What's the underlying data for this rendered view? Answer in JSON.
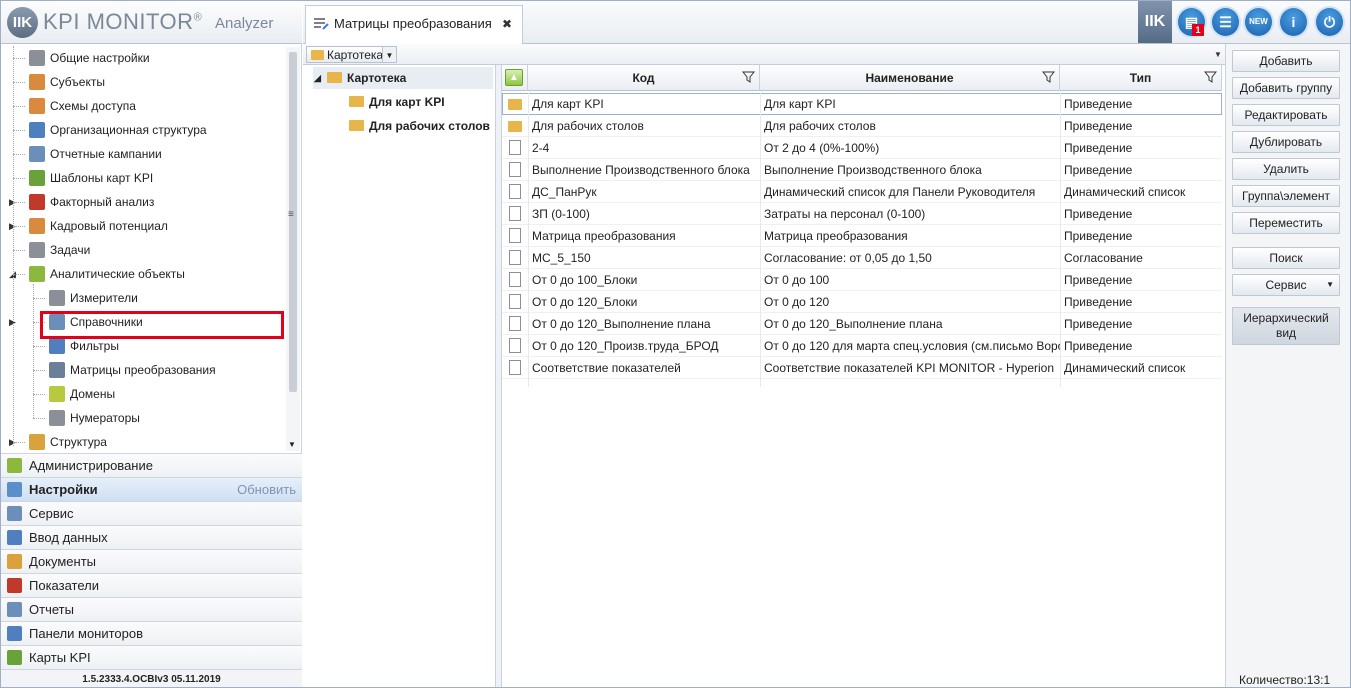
{
  "app": {
    "logo_mark": "IIK",
    "title": "KPI MONITOR",
    "reg": "®",
    "subtitle": "Analyzer",
    "version": "1.5.2333.4.OCBIv3  05.11.2019"
  },
  "tree": {
    "items": [
      {
        "label": "Общие настройки",
        "icon": "gear-icon",
        "color": "#8b8f97"
      },
      {
        "label": "Субъекты",
        "icon": "users-icon",
        "color": "#d98a3c"
      },
      {
        "label": "Схемы доступа",
        "icon": "access-icon",
        "color": "#d98a3c"
      },
      {
        "label": "Организационная структура",
        "icon": "org-icon",
        "color": "#4f7fbf"
      },
      {
        "label": "Отчетные кампании",
        "icon": "calendar-icon",
        "color": "#6b8fb8"
      },
      {
        "label": "Шаблоны карт KPI",
        "icon": "template-icon",
        "color": "#6aa23a"
      },
      {
        "label": "Факторный анализ",
        "icon": "beta-icon",
        "color": "#c0392b"
      },
      {
        "label": "Кадровый потенциал",
        "icon": "people-icon",
        "color": "#d98a3c"
      },
      {
        "label": "Задачи",
        "icon": "tasks-icon",
        "color": "#8b8f97"
      },
      {
        "label": "Аналитические объекты",
        "icon": "cubes-icon",
        "color": "#8cb83f"
      },
      {
        "label": "Измерители",
        "icon": "meter-icon",
        "color": "#8b8f97"
      },
      {
        "label": "Справочники",
        "icon": "book-icon",
        "color": "#6b8fb8"
      },
      {
        "label": "Фильтры",
        "icon": "filter-icon",
        "color": "#4f7fbf"
      },
      {
        "label": "Матрицы преобразования",
        "icon": "matrix-icon",
        "color": "#6b7f99"
      },
      {
        "label": "Домены",
        "icon": "domain-icon",
        "color": "#b8c93f"
      },
      {
        "label": "Нумераторы",
        "icon": "numerator-icon",
        "color": "#8b8f97"
      },
      {
        "label": "Структура",
        "icon": "structure-icon",
        "color": "#d9a23c"
      }
    ]
  },
  "nav": {
    "items": [
      {
        "label": "Администрирование",
        "color": "#8cb83f"
      },
      {
        "label": "Настройки",
        "color": "#5b8fc9"
      },
      {
        "label": "Сервис",
        "color": "#6b8fb8"
      },
      {
        "label": "Ввод данных",
        "color": "#4f7fbf"
      },
      {
        "label": "Документы",
        "color": "#d9a23c"
      },
      {
        "label": "Показатели",
        "color": "#c0392b"
      },
      {
        "label": "Отчеты",
        "color": "#6b8fb8"
      },
      {
        "label": "Панели мониторов",
        "color": "#4f7fbf"
      },
      {
        "label": "Карты KPI",
        "color": "#6aa23a"
      }
    ],
    "refresh_label": "Обновить"
  },
  "tab": {
    "label": "Матрицы преобразования",
    "close": "✖"
  },
  "toolbar": {
    "badge": "1",
    "new_label": "NEW",
    "info": "i",
    "power": "⏻",
    "home": "IIK"
  },
  "breadcrumb": {
    "label": "Картотека"
  },
  "folder_tree": {
    "root": "Картотека",
    "children": [
      "Для карт KPI",
      "Для рабочих столов"
    ]
  },
  "grid": {
    "columns": [
      "Код",
      "Наименование",
      "Тип"
    ],
    "rows": [
      {
        "kind": "folder",
        "code": "Для карт KPI",
        "name": "Для карт KPI",
        "type": "Приведение"
      },
      {
        "kind": "folder",
        "code": "Для рабочих столов",
        "name": "Для рабочих столов",
        "type": "Приведение"
      },
      {
        "kind": "doc",
        "code": "2-4",
        "name": "От 2 до 4 (0%-100%)",
        "type": "Приведение"
      },
      {
        "kind": "doc",
        "code": "Выполнение Производственного блока",
        "name": "Выполнение Производственного блока",
        "type": "Приведение"
      },
      {
        "kind": "doc",
        "code": "ДС_ПанРук",
        "name": "Динамический список для Панели Руководителя",
        "type": "Динамический список"
      },
      {
        "kind": "doc",
        "code": "ЗП (0-100)",
        "name": "Затраты на персонал (0-100)",
        "type": "Приведение"
      },
      {
        "kind": "doc",
        "code": "Матрица преобразования",
        "name": "Матрица преобразования",
        "type": "Приведение"
      },
      {
        "kind": "doc",
        "code": "МС_5_150",
        "name": "Согласование: от 0,05 до 1,50",
        "type": "Согласование"
      },
      {
        "kind": "doc",
        "code": "От 0 до 100_Блоки",
        "name": "От 0 до 100",
        "type": "Приведение"
      },
      {
        "kind": "doc",
        "code": "От 0 до 120_Блоки",
        "name": "От 0 до 120",
        "type": "Приведение"
      },
      {
        "kind": "doc",
        "code": "От 0 до 120_Выполнение плана",
        "name": "От 0 до 120_Выполнение плана",
        "type": "Приведение"
      },
      {
        "kind": "doc",
        "code": "От 0 до 120_Произв.труда_БРОД",
        "name": "От 0 до 120 для марта спец.условия (см.письмо Воро",
        "type": "Приведение"
      },
      {
        "kind": "doc",
        "code": "Соответствие показателей",
        "name": "Соответствие показателей KPI MONITOR - Hyperion",
        "type": "Динамический список"
      }
    ]
  },
  "actions": {
    "buttons": [
      "Добавить",
      "Добавить группу",
      "Редактировать",
      "Дублировать",
      "Удалить",
      "Группа\\элемент",
      "Переместить"
    ],
    "search": "Поиск",
    "service": "Сервис",
    "hierarchy_line1": "Иерархический",
    "hierarchy_line2": "вид"
  },
  "status": {
    "count": "Количество:13:1"
  }
}
